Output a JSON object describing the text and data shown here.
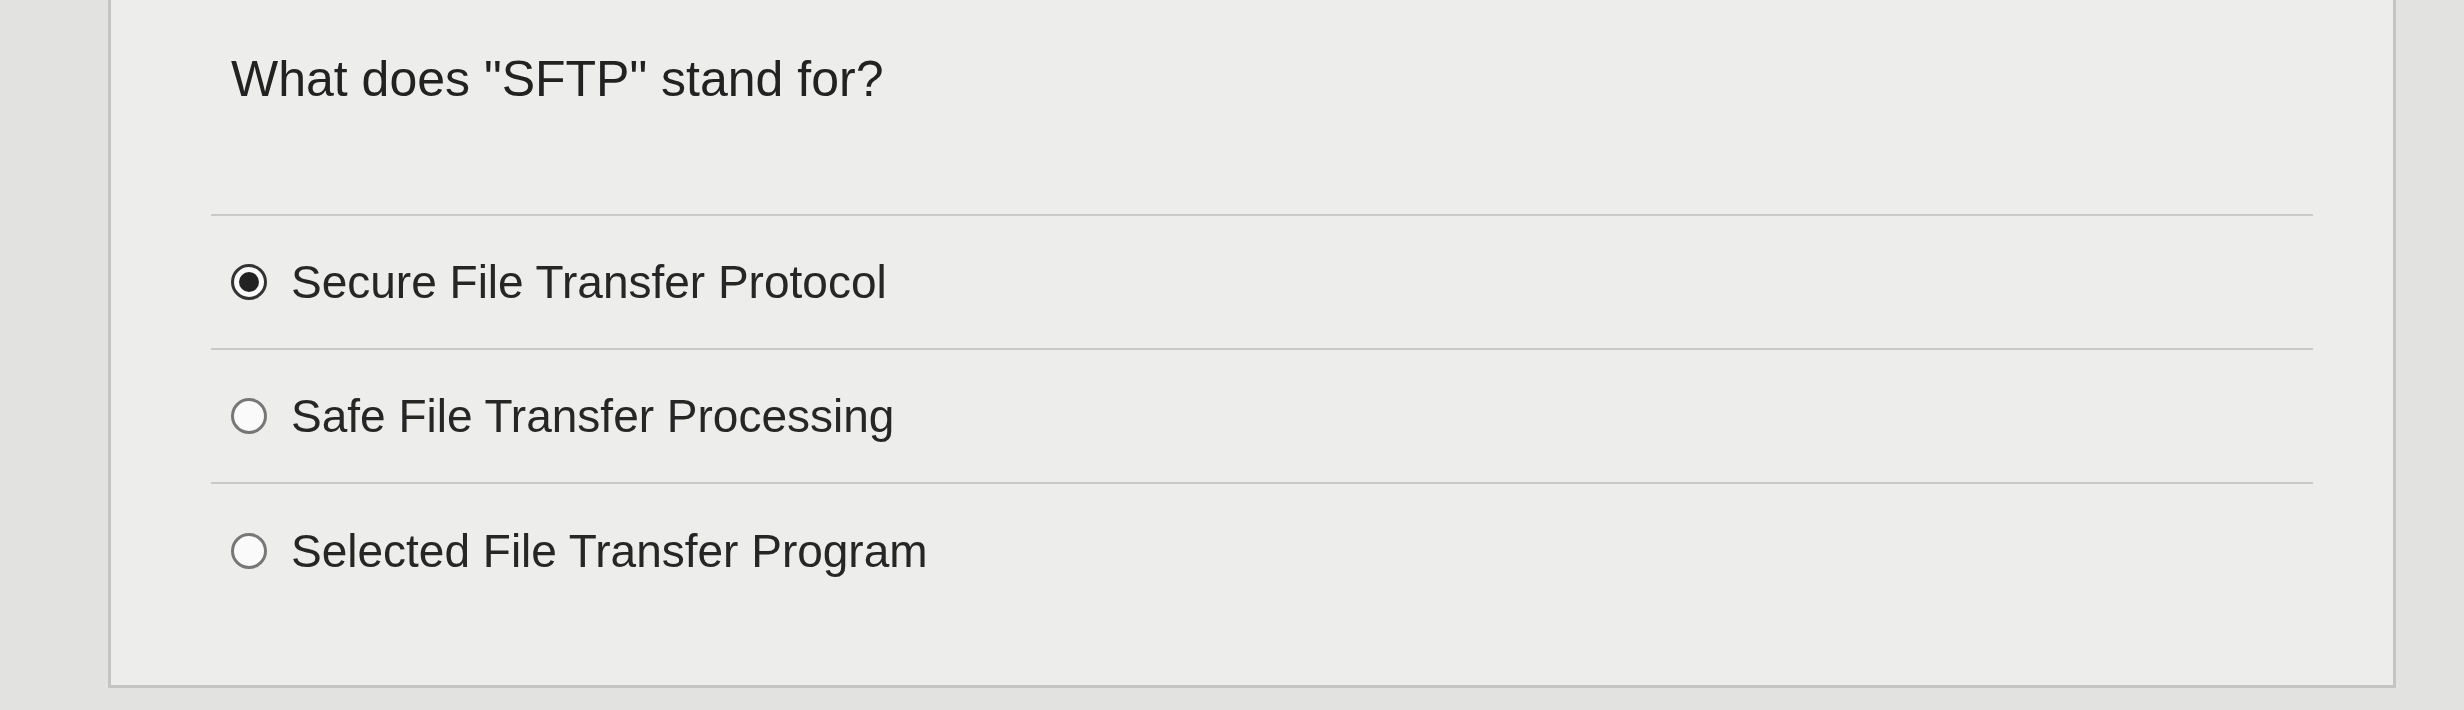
{
  "question": {
    "text": "What does \"SFTP\" stand for?"
  },
  "options": [
    {
      "label": "Secure File Transfer Protocol",
      "selected": true
    },
    {
      "label": "Safe File Transfer Processing",
      "selected": false
    },
    {
      "label": "Selected File Transfer Program",
      "selected": false
    }
  ]
}
